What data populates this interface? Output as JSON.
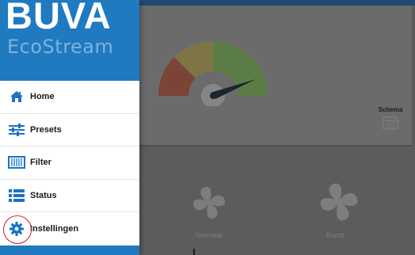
{
  "drawer": {
    "brand": "BUVA",
    "sub_brand": "EcoStream",
    "items": [
      {
        "label": "Home",
        "icon": "home-icon"
      },
      {
        "label": "Presets",
        "icon": "sliders-icon"
      },
      {
        "label": "Filter",
        "icon": "filter-icon"
      },
      {
        "label": "Status",
        "icon": "list-icon"
      },
      {
        "label": "Instellingen",
        "icon": "gear-icon"
      }
    ]
  },
  "main": {
    "schema_label": "Schema",
    "modes": [
      {
        "label": "Normaal"
      },
      {
        "label": "Boost"
      }
    ]
  },
  "colors": {
    "brand_blue": "#1f7ac0",
    "icon_blue": "#1b74c2",
    "gauge_red": "#c74a2f",
    "gauge_yellow": "#e1c23a",
    "gauge_green": "#6fb83a",
    "highlight_red": "#c8201f"
  }
}
